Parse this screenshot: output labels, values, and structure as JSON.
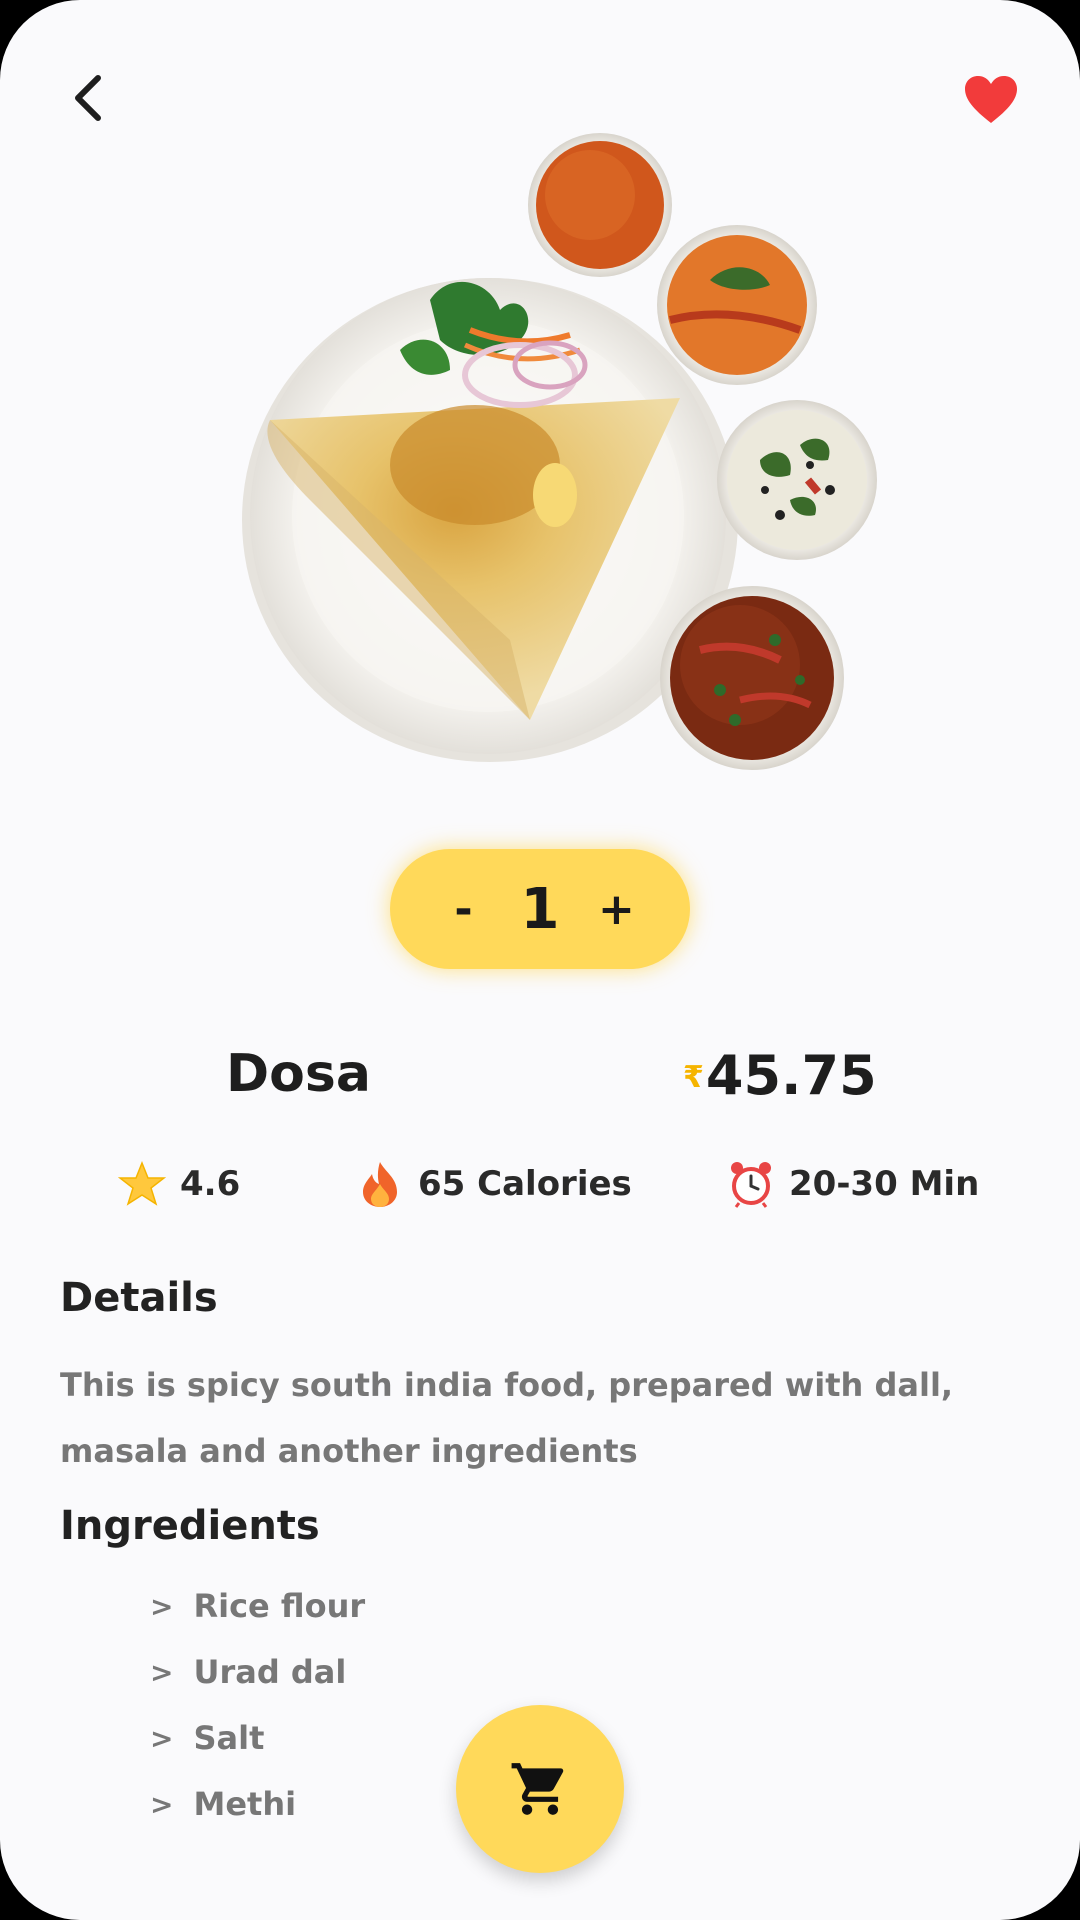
{
  "colors": {
    "accent": "#ffd95a",
    "heart": "#f23b3b",
    "currency": "#f5b400",
    "muted_text": "#777777"
  },
  "header": {
    "back_icon": "chevron-left-icon",
    "favorite_icon": "heart-icon"
  },
  "stepper": {
    "minus": "-",
    "value": "1",
    "plus": "+"
  },
  "product": {
    "name": "Dosa",
    "currency_symbol": "₹",
    "price": "45.75"
  },
  "stats": {
    "rating": "4.6",
    "calories": "65 Calories",
    "time": "20-30 Min"
  },
  "details": {
    "title": "Details",
    "text": "This is spicy south india food, prepared with dall, masala and another ingredients"
  },
  "ingredients": {
    "title": "Ingredients",
    "items": [
      {
        "marker": ">",
        "label": "Rice flour"
      },
      {
        "marker": ">",
        "label": "Urad dal"
      },
      {
        "marker": ">",
        "label": "Salt"
      },
      {
        "marker": ">",
        "label": "Methi"
      }
    ]
  },
  "cart": {
    "icon": "cart-icon"
  }
}
